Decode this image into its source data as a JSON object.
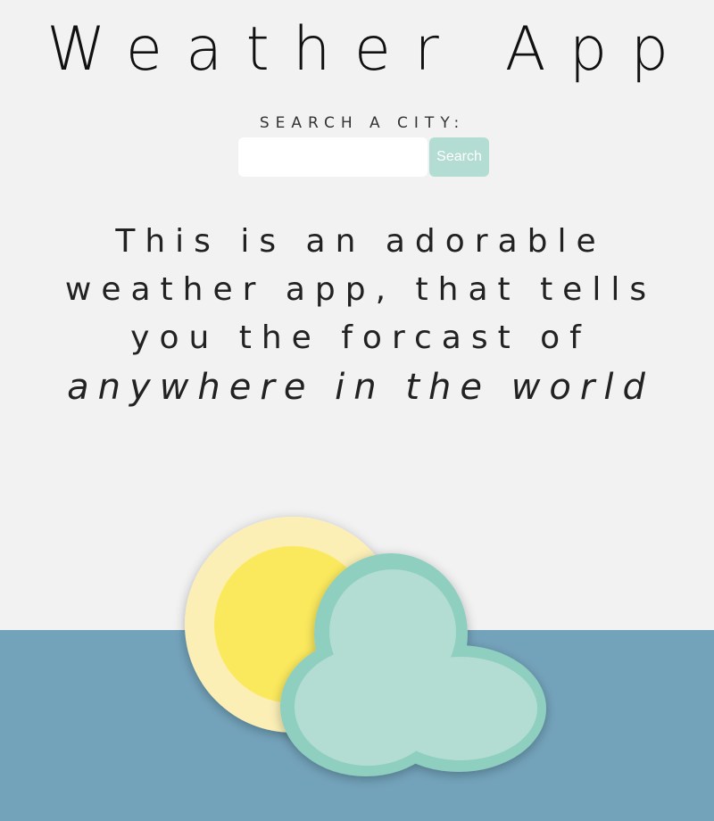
{
  "header": {
    "title": "Weather App"
  },
  "search": {
    "label": "SEARCH A CITY:",
    "input_value": "",
    "placeholder": "",
    "button_label": "Search"
  },
  "intro": {
    "line1": "This is an adorable",
    "line2": "weather app, that tells",
    "line3": "you the forcast of",
    "emphasis": "anywhere in the world"
  },
  "illustration": {
    "icon": "sun-behind-cloud-icon",
    "colors": {
      "sun_outer": "#fbefb6",
      "sun_inner": "#fbe95d",
      "cloud_outer": "#8fcfbf",
      "cloud_inner": "#b3ddd2"
    }
  },
  "colors": {
    "background": "#f2f2f2",
    "footer_band": "#73a3bb",
    "accent": "#b3ddd2"
  }
}
